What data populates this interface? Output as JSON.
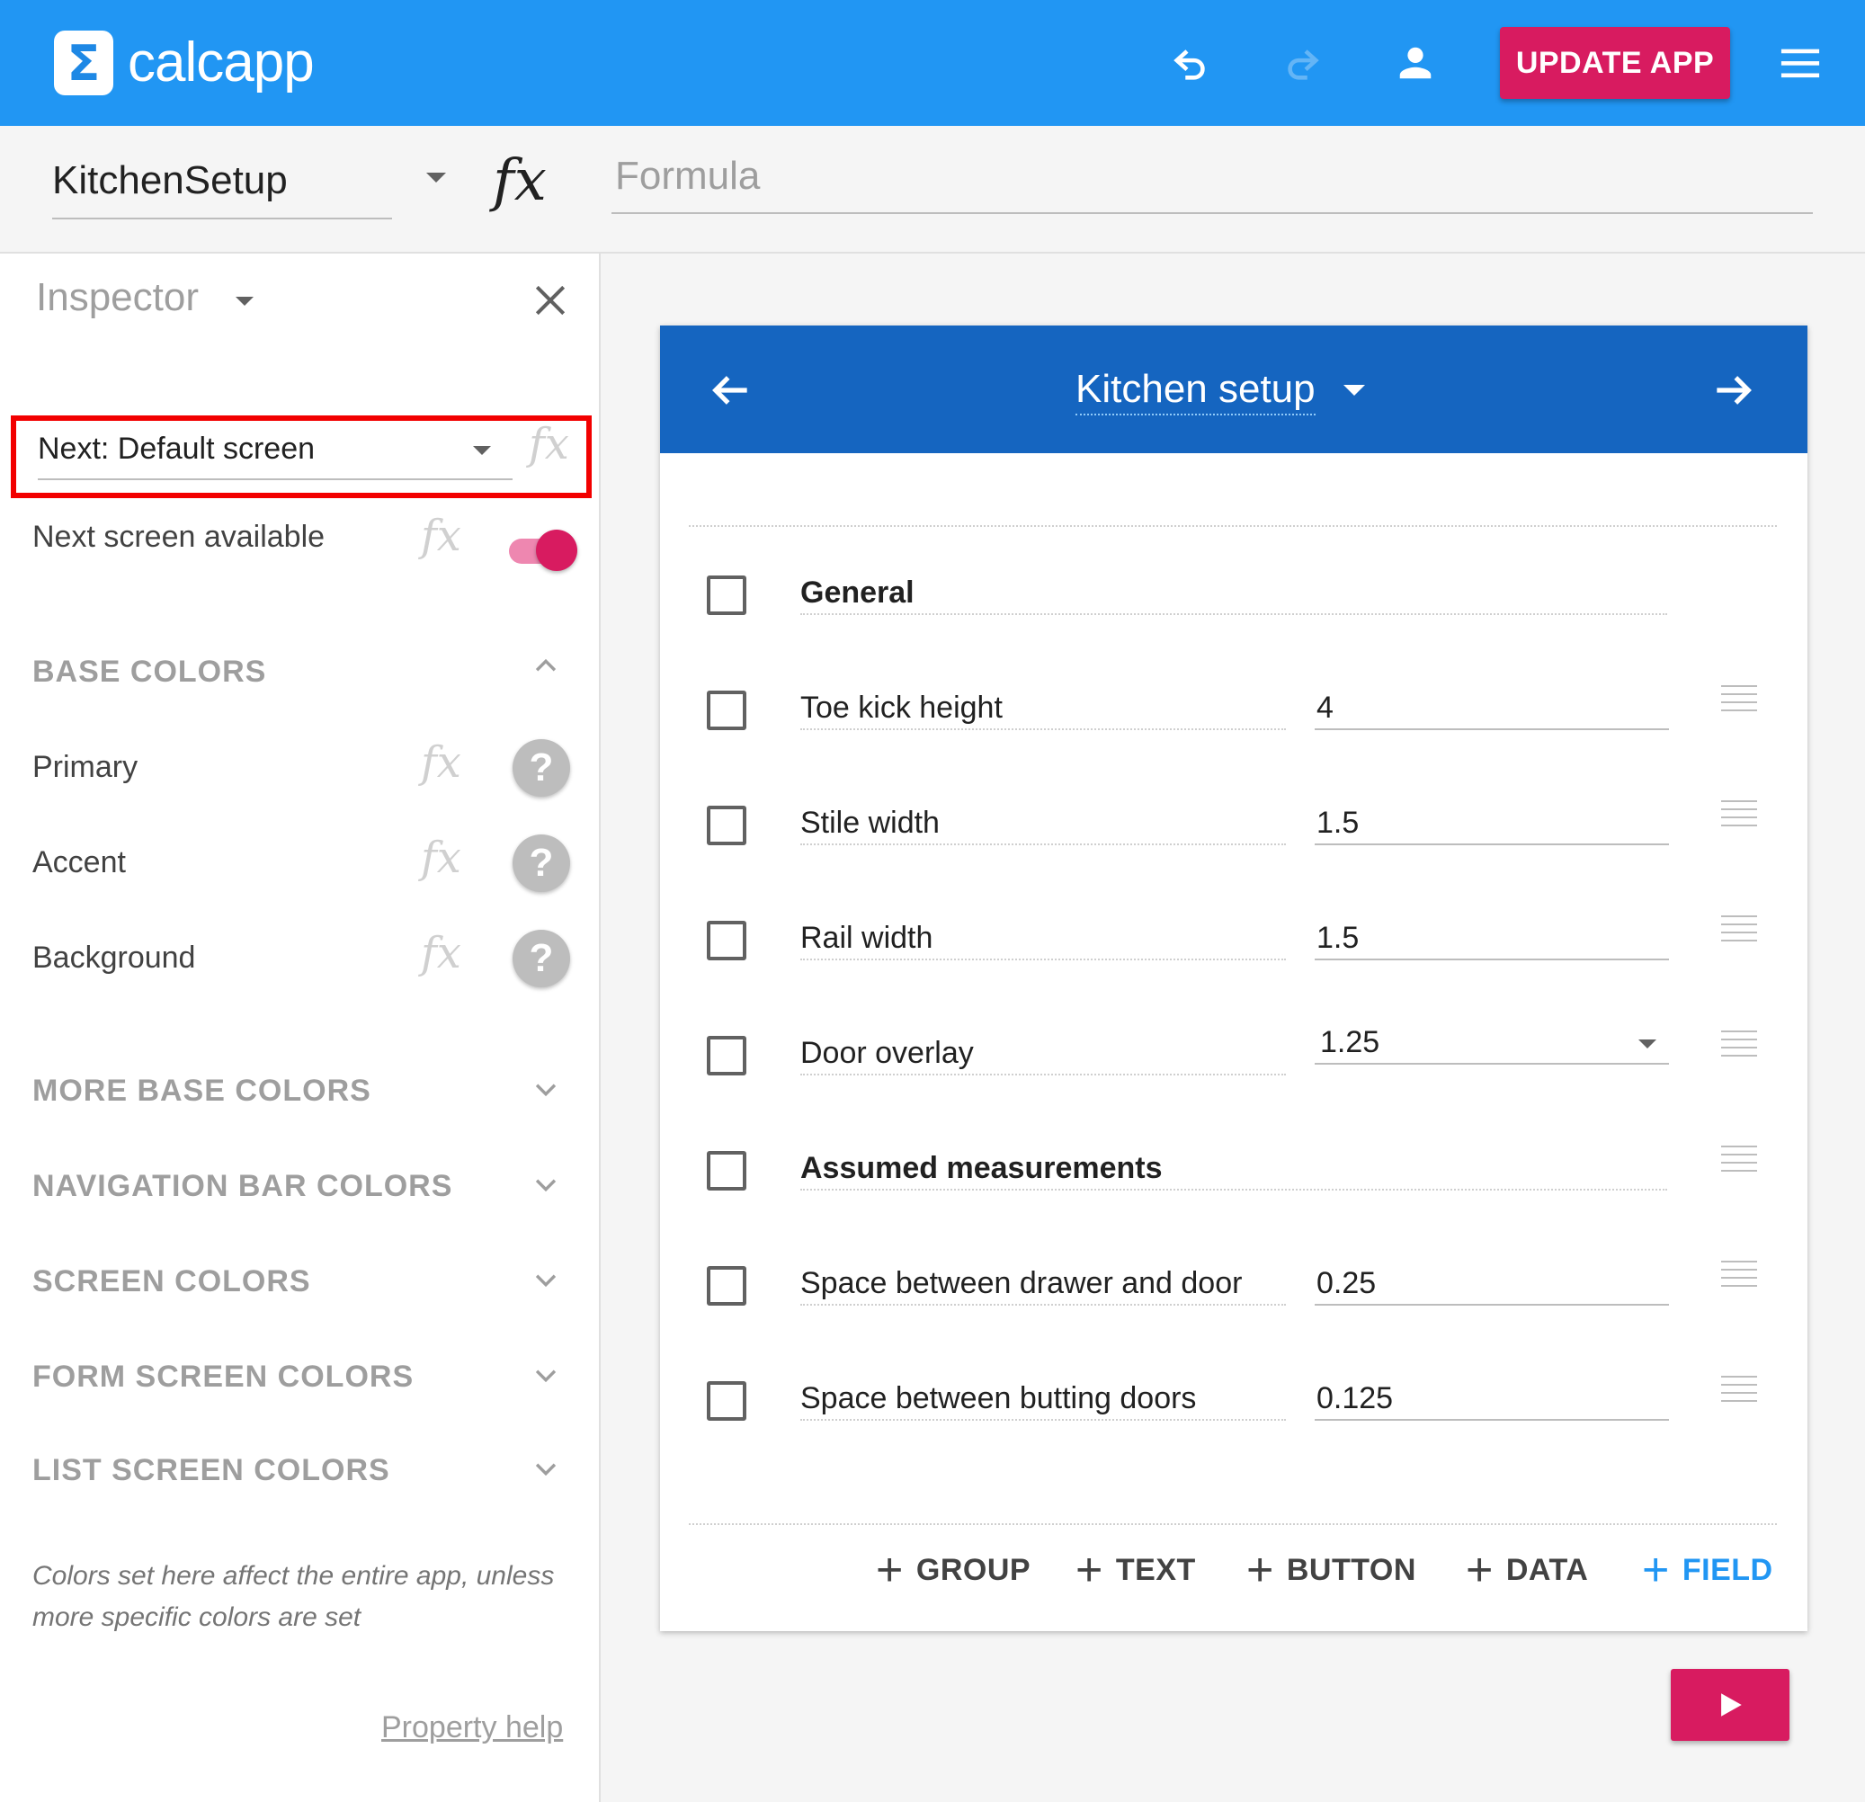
{
  "app": {
    "logo_symbol": "Σ",
    "name": "calcapp",
    "update_label": "UPDATE APP",
    "icons": [
      "undo-icon",
      "redo-icon",
      "account-icon",
      "menu-icon"
    ],
    "colors": {
      "primary": "#2196f3",
      "accent": "#d81b60",
      "screen_header": "#1565c0"
    }
  },
  "toolbar": {
    "screen_name": "KitchenSetup",
    "fx_symbol": "fx",
    "formula_placeholder": "Formula"
  },
  "inspector": {
    "title": "Inspector",
    "next_screen_value": "Next: Default screen",
    "fx_symbol": "fx",
    "next_available_label": "Next screen available",
    "next_available_on": true,
    "sections": {
      "base_colors": "BASE COLORS",
      "more_base_colors": "MORE BASE COLORS",
      "navigation_bar_colors": "NAVIGATION BAR COLORS",
      "screen_colors": "SCREEN COLORS",
      "form_screen_colors": "FORM SCREEN COLORS",
      "list_screen_colors": "LIST SCREEN COLORS"
    },
    "color_props": [
      {
        "label": "Primary",
        "help": "?"
      },
      {
        "label": "Accent",
        "help": "?"
      },
      {
        "label": "Background",
        "help": "?"
      }
    ],
    "note": "Colors set here affect the entire app, unless more specific colors are set",
    "property_help": "Property help"
  },
  "screen": {
    "title": "Kitchen setup",
    "rows": [
      {
        "label": "General",
        "kind": "group"
      },
      {
        "label": "Toe kick height",
        "value": "4",
        "kind": "field"
      },
      {
        "label": "Stile width",
        "value": "1.5",
        "kind": "field"
      },
      {
        "label": "Rail width",
        "value": "1.5",
        "kind": "field"
      },
      {
        "label": "Door overlay",
        "value": "1.25",
        "kind": "select"
      },
      {
        "label": "Assumed measurements",
        "kind": "group"
      },
      {
        "label": "Space between drawer and door",
        "value": "0.25",
        "kind": "field"
      },
      {
        "label": "Space between butting doors",
        "value": "0.125",
        "kind": "field"
      }
    ],
    "add_buttons": {
      "group": "GROUP",
      "text": "TEXT",
      "button": "BUTTON",
      "data": "DATA",
      "field": "FIELD"
    },
    "plus_symbol": "+"
  }
}
